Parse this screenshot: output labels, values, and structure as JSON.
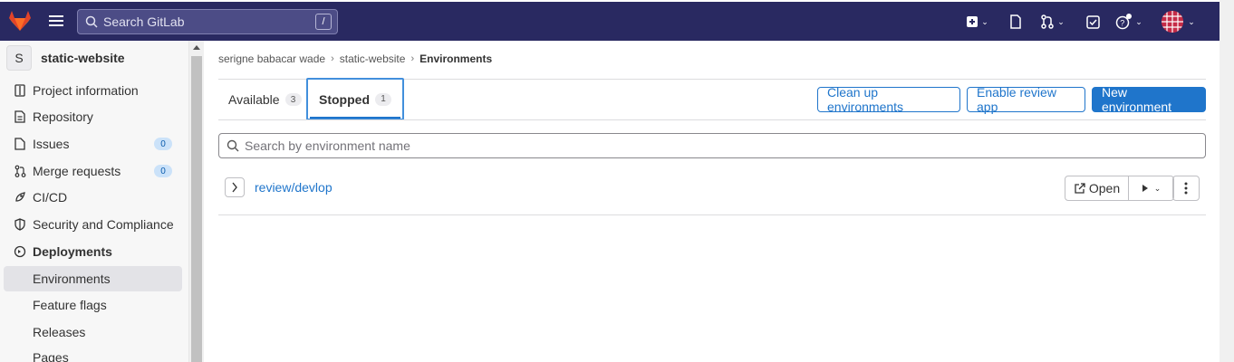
{
  "topbar": {
    "search_placeholder": "Search GitLab",
    "search_shortcut": "/",
    "icons": [
      "gitlab-logo-icon",
      "hamburger-icon",
      "plus-square-icon",
      "issues-icon",
      "merge-request-icon",
      "todo-icon",
      "help-icon",
      "avatar"
    ],
    "background": "#292961"
  },
  "sidebar": {
    "project_initial": "S",
    "project_name": "static-website",
    "items": [
      {
        "label": "Project information"
      },
      {
        "label": "Repository"
      },
      {
        "label": "Issues",
        "badge": "0"
      },
      {
        "label": "Merge requests",
        "badge": "0"
      },
      {
        "label": "CI/CD"
      },
      {
        "label": "Security and Compliance"
      },
      {
        "label": "Deployments"
      },
      {
        "label": "Environments",
        "active": true
      },
      {
        "label": "Feature flags"
      },
      {
        "label": "Releases"
      },
      {
        "label": "Pages"
      }
    ]
  },
  "breadcrumb": [
    "serigne babacar wade",
    "static-website",
    "Environments"
  ],
  "tabs": [
    {
      "label": "Available",
      "count": "3"
    },
    {
      "label": "Stopped",
      "count": "1",
      "active": true
    }
  ],
  "actions": {
    "cleanup": "Clean up environments",
    "review_app": "Enable review app",
    "new_env": "New environment"
  },
  "env_search_placeholder": "Search by environment name",
  "environments": [
    {
      "name": "review/devlop",
      "open_label": "Open"
    }
  ],
  "colors": {
    "accent": "#1f75cb",
    "nav": "#292961"
  }
}
